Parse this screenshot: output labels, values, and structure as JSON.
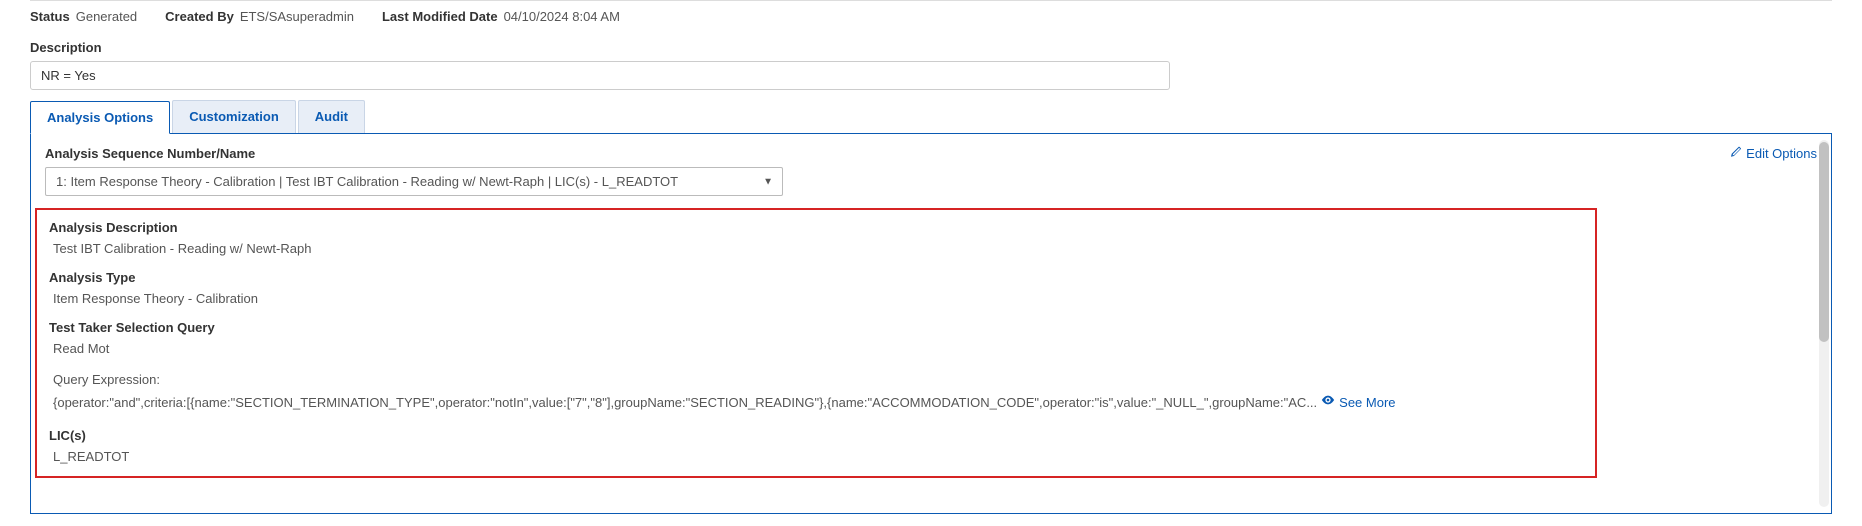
{
  "meta": {
    "statusLabel": "Status",
    "statusValue": "Generated",
    "createdByLabel": "Created By",
    "createdByValue": "ETS/SAsuperadmin",
    "lastModLabel": "Last Modified Date",
    "lastModValue": "04/10/2024 8:04 AM"
  },
  "descriptionLabel": "Description",
  "descriptionValue": "NR = Yes",
  "tabs": {
    "t0": "Analysis Options",
    "t1": "Customization",
    "t2": "Audit"
  },
  "panel": {
    "seqLabel": "Analysis Sequence Number/Name",
    "editLabel": "Edit Options",
    "selectValue": "1: Item Response Theory - Calibration | Test IBT Calibration - Reading w/ Newt-Raph | LIC(s) - L_READTOT",
    "analysisDescLabel": "Analysis Description",
    "analysisDescValue": "Test IBT Calibration - Reading w/ Newt-Raph",
    "analysisTypeLabel": "Analysis Type",
    "analysisTypeValue": "Item Response Theory - Calibration",
    "ttsqLabel": "Test Taker Selection Query",
    "ttsqValue": "Read Mot",
    "queryExpLabel": "Query Expression:",
    "queryExpValue": "{operator:\"and\",criteria:[{name:\"SECTION_TERMINATION_TYPE\",operator:\"notIn\",value:[\"7\",\"8\"],groupName:\"SECTION_READING\"},{name:\"ACCOMMODATION_CODE\",operator:\"is\",value:\"_NULL_\",groupName:\"AC...",
    "seeMore": "See More",
    "licsLabel": "LIC(s)",
    "licsValue": "L_READTOT"
  }
}
